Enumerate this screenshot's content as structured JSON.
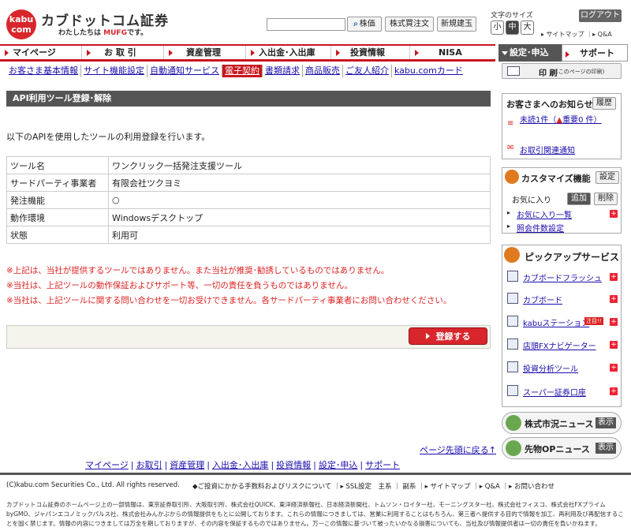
{
  "header": {
    "logo_text": "kabu com",
    "brand": "カブドットコム証券",
    "tagline_prefix": "わたしたちは",
    "tagline_brand": "MUFG",
    "tagline_suffix": "です。",
    "search_placeholder": "",
    "search_button": "株価",
    "buttons": [
      "株式買注文",
      "新規建玉"
    ],
    "font_size_label": "文字のサイズ",
    "font_sizes": [
      "小",
      "中",
      "大"
    ],
    "logout": "ログアウト",
    "links": "▸ サイトマップ ｜▸ Q&A"
  },
  "gnav": {
    "items": [
      "マイページ",
      "お 取 引",
      "資産管理",
      "入出金･入出庫",
      "投資情報",
      "NISA"
    ],
    "setting": "設定･申込",
    "support": "サポート"
  },
  "subnav": {
    "items": [
      "お客さま基本情報",
      "サイト機能設定",
      "自動通知サービス",
      "電子契約",
      "書類請求",
      "商品販売",
      "ご友人紹介",
      "kabu.comカード"
    ],
    "active_index": 3
  },
  "print": {
    "label": "印 刷",
    "note": "(このページの印刷)"
  },
  "main": {
    "title": "API利用ツール登録･解除",
    "intro": "以下のAPIを使用したツールの利用登録を行います。",
    "table": [
      {
        "label": "ツール名",
        "value": "ワンクリック一括発注支援ツール"
      },
      {
        "label": "サードパーティ事業者",
        "value": "有限会社ツクヨミ"
      },
      {
        "label": "発注機能",
        "value": "○"
      },
      {
        "label": "動作環境",
        "value": "Windowsデスクトップ"
      },
      {
        "label": "状態",
        "value": "利用可"
      }
    ],
    "notes": [
      "※上記は、当社が提供するツールではありません。また当社が推奨･勧誘しているものではありません。",
      "※当社は、上記ツールの動作保証およびサポート等、一切の責任を負うものではありません。",
      "※当社は、上記ツールに関する問い合わせを一切お受けできません。各サードパーティ事業者にお問い合わせください。"
    ],
    "register_button": "登録する",
    "page_top": "ページ先頭に戻る↑",
    "footer_nav": [
      "マイページ",
      "お取引",
      "資産管理",
      "入出金･入出庫",
      "投資情報",
      "設定･申込",
      "サポート"
    ]
  },
  "sidebar": {
    "notice": {
      "title": "お客さまへのお知らせ",
      "history_btn": "履歴",
      "unread": "未読1件（",
      "important": "重要0",
      "unread_tail": "件）",
      "mail_link": "お取引関連通知"
    },
    "customize": {
      "title": "カスタマイズ機能",
      "setting_btn": "設定",
      "favorites": "お気に入り",
      "add_btn": "追加",
      "delete_btn": "削除",
      "links": [
        "お気に入り一覧",
        "照会件数設定"
      ]
    },
    "pickup": {
      "title": "ピックアップサービス",
      "items": [
        "カブボードフラッシュ",
        "カブボード",
        "kabuステーション",
        "店頭FXナビゲーター",
        "投資分析ツール",
        "スーパー証券口座"
      ],
      "badge": "注目!!"
    },
    "news": [
      {
        "label": "株式市況ニュース",
        "btn": "表示"
      },
      {
        "label": "先物OPニュース",
        "btn": "表示"
      }
    ]
  },
  "footer": {
    "copyright": "(C)kabu.com Securities Co., Ltd. All rights reserved.",
    "links": "◆ご投資にかかる手数料およびリスクについて ｜▸ SSL設定　主系 ｜ 副系 ｜▸ サイトマップ ｜▸ Q&A ｜▸ お問い合わせ",
    "disclaimer": "カブドットコム証券のホームページ上の一部情報は、東京証券取引所、大阪取引所、株式会社QUICK、東洋経済新報社、日本経済新聞社、トムソン・ロイター社、モーニングスター社、株式会社フィスコ、株式会社FXプライムbyGMO、ジャパンエコノミックパルス社、株式会社みんかぶからの情報提供をもとに公開しております。これらの情報につきましては、営業に利用することはもちろん、第三者へ提供する目的で情報を加工、再利用及び再配信することを固く禁じます。情報の内容につきましては万全を期しておりますが、その内容を保証するものではありません。万一この情報に基づいて被ったいかなる損害についても、当社及び情報提供者は一切の責任を負いかねます。"
  }
}
